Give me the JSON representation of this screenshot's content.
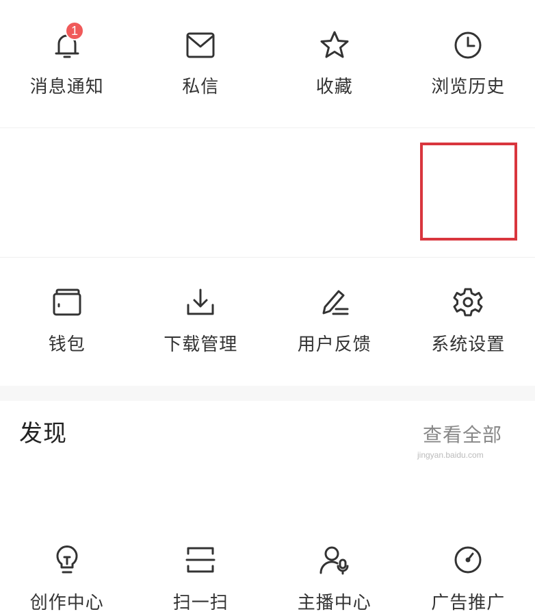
{
  "menu": {
    "rows": [
      [
        {
          "label": "消息通知",
          "icon": "bell-icon",
          "badge": "1"
        },
        {
          "label": "私信",
          "icon": "mail-icon"
        },
        {
          "label": "收藏",
          "icon": "star-icon"
        },
        {
          "label": "浏览历史",
          "icon": "clock-icon"
        }
      ],
      [
        {
          "label": "钱包",
          "icon": "wallet-icon"
        },
        {
          "label": "下载管理",
          "icon": "download-icon"
        },
        {
          "label": "用户反馈",
          "icon": "pencil-icon"
        },
        {
          "label": "系统设置",
          "icon": "gear-icon",
          "highlighted": true
        }
      ],
      [
        {
          "label": "创作中心",
          "icon": "lightbulb-icon"
        },
        {
          "label": "扫一扫",
          "icon": "scan-icon"
        },
        {
          "label": "主播中心",
          "icon": "anchor-mic-icon"
        },
        {
          "label": "广告推广",
          "icon": "gauge-icon"
        }
      ]
    ]
  },
  "discover": {
    "title": "发现",
    "more": "查看全部"
  },
  "watermark": "jingyan.baidu.com",
  "colors": {
    "highlight_border": "#d9363e",
    "badge_bg": "#f05a5a",
    "text": "#333333"
  }
}
